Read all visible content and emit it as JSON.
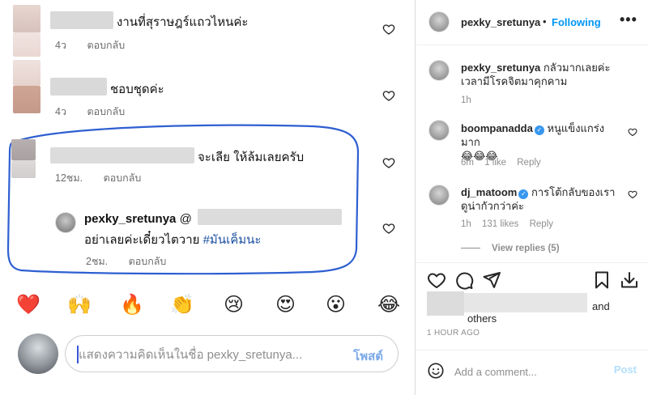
{
  "left_panel": {
    "comments": [
      {
        "text": "งานที่สุราษฎร์แถวไหนค่ะ",
        "time": "4ว",
        "reply_label": "ตอบกลับ"
      },
      {
        "text": "ชอบชุดค่ะ",
        "time": "4ว",
        "reply_label": "ตอบกลับ"
      },
      {
        "text": "จะเลีย ให้ล้มเลยครับ",
        "time": "12ชม.",
        "reply_label": "ตอบกลับ"
      }
    ],
    "reply": {
      "username": "pexky_sretunya",
      "at_prefix": "@",
      "text": "อย่าเลยค่ะเดี๋ยวไตวาย",
      "hashtag": "#มันเค็มนะ",
      "time": "2ชม.",
      "reply_label": "ตอบกลับ"
    },
    "emoji_bar": [
      "❤️",
      "🙌",
      "🔥",
      "👏",
      "😢",
      "😍",
      "😮",
      "😂"
    ],
    "comment_input": {
      "placeholder": "แสดงความคิดเห็นในชื่อ pexky_sretunya...",
      "post_label": "โพสต์"
    },
    "colors": {
      "highlight_outline": "#2e5fd1",
      "post_button": "#7aa9ea"
    }
  },
  "right_panel": {
    "header": {
      "username": "pexky_sretunya",
      "dot": "•",
      "follow_label": "Following",
      "more_label": "•••"
    },
    "caption": {
      "username": "pexky_sretunya",
      "text": "กลัวมากเลยค่ะ เวลามีโรคจิตมาคุกคาม",
      "time": "1h"
    },
    "comments": [
      {
        "username": "boompanadda",
        "verified": true,
        "text": "หนูแข็งแกร่งมาก",
        "emoji": "😂😂😂",
        "time": "6m",
        "likes": "1 like",
        "reply_label": "Reply"
      },
      {
        "username": "dj_matoom",
        "verified": true,
        "text": "การโต้กลับของเรา ดูน่ากัวกว่าค่ะ",
        "time": "1h",
        "likes": "131 likes",
        "reply_label": "Reply"
      }
    ],
    "view_replies": "View replies (5)",
    "likes_line": {
      "and": "and",
      "others": "others"
    },
    "timestamp": "1 HOUR AGO",
    "add_comment": {
      "placeholder": "Add a comment...",
      "post_label": "Post"
    },
    "colors": {
      "follow": "#0095f6",
      "verified": "#3897f0",
      "post_disabled": "#b2dffc"
    }
  }
}
